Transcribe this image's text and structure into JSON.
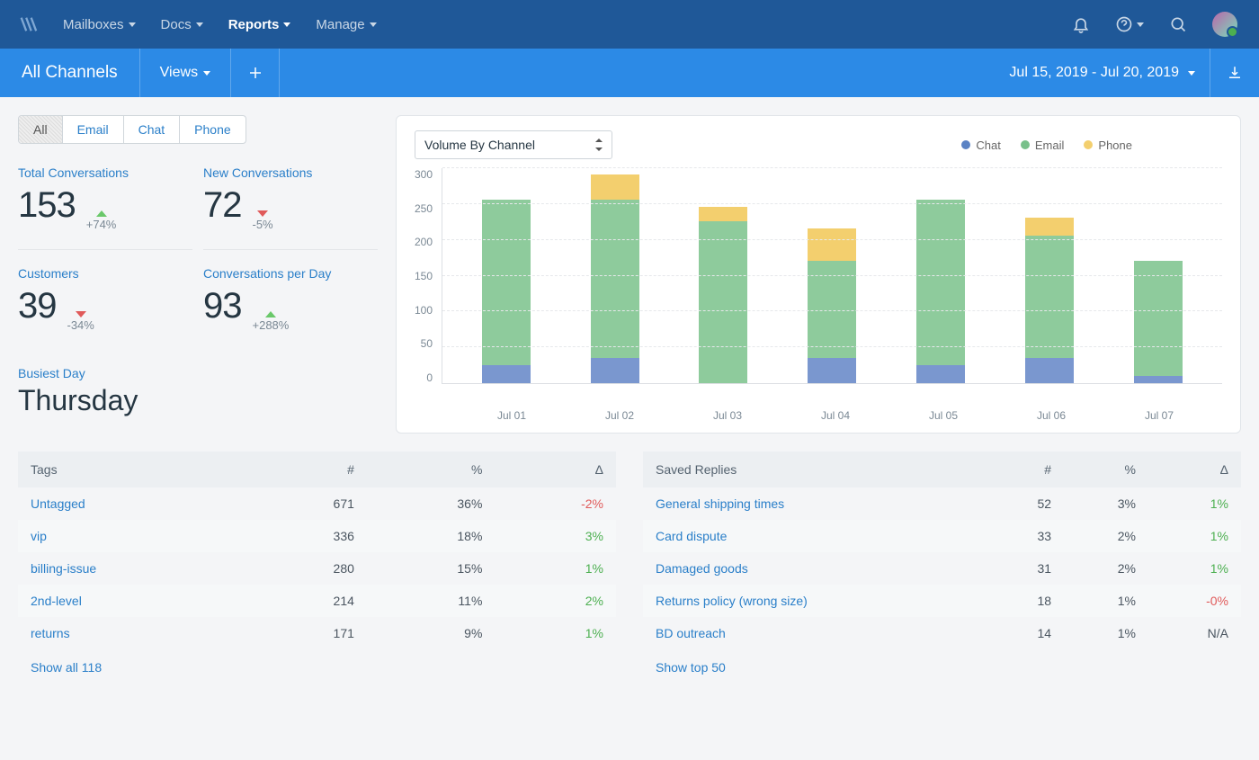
{
  "topnav": {
    "items": [
      {
        "label": "Mailboxes"
      },
      {
        "label": "Docs"
      },
      {
        "label": "Reports"
      },
      {
        "label": "Manage"
      }
    ]
  },
  "subnav": {
    "title": "All Channels",
    "views_label": "Views",
    "date_range": "Jul 15, 2019 - Jul 20, 2019"
  },
  "segments": [
    {
      "label": "All",
      "active": true
    },
    {
      "label": "Email"
    },
    {
      "label": "Chat"
    },
    {
      "label": "Phone"
    }
  ],
  "stats": {
    "total_conversations": {
      "label": "Total Conversations",
      "value": "153",
      "trend": "+74%",
      "dir": "up"
    },
    "new_conversations": {
      "label": "New Conversations",
      "value": "72",
      "trend": "-5%",
      "dir": "down"
    },
    "customers": {
      "label": "Customers",
      "value": "39",
      "trend": "-34%",
      "dir": "down"
    },
    "per_day": {
      "label": "Conversations per Day",
      "value": "93",
      "trend": "+288%",
      "dir": "up"
    },
    "busiest_label": "Busiest Day",
    "busiest_value": "Thursday"
  },
  "chart_selector": "Volume By Channel",
  "legend": {
    "chat": "Chat",
    "email": "Email",
    "phone": "Phone"
  },
  "chart_data": {
    "type": "bar",
    "title": "Volume By Channel",
    "categories": [
      "Jul 01",
      "Jul 02",
      "Jul 03",
      "Jul 04",
      "Jul 05",
      "Jul 06",
      "Jul 07"
    ],
    "series": [
      {
        "name": "Chat",
        "values": [
          25,
          35,
          0,
          35,
          25,
          35,
          10
        ]
      },
      {
        "name": "Email",
        "values": [
          230,
          220,
          225,
          135,
          230,
          170,
          160
        ]
      },
      {
        "name": "Phone",
        "values": [
          0,
          35,
          20,
          45,
          0,
          25,
          0
        ]
      }
    ],
    "ylabel": "",
    "ylim": [
      0,
      300
    ],
    "yticks": [
      0,
      50,
      100,
      150,
      200,
      250,
      300
    ]
  },
  "tags_table": {
    "title": "Tags",
    "cols": [
      "#",
      "%",
      "Δ"
    ],
    "rows": [
      {
        "name": "Untagged",
        "n": "671",
        "p": "36%",
        "d": "-2%",
        "dir": "neg"
      },
      {
        "name": "vip",
        "n": "336",
        "p": "18%",
        "d": "3%",
        "dir": "pos"
      },
      {
        "name": "billing-issue",
        "n": "280",
        "p": "15%",
        "d": "1%",
        "dir": "pos"
      },
      {
        "name": "2nd-level",
        "n": "214",
        "p": "11%",
        "d": "2%",
        "dir": "pos"
      },
      {
        "name": "returns",
        "n": "171",
        "p": "9%",
        "d": "1%",
        "dir": "pos"
      }
    ],
    "show_more": "Show all 118"
  },
  "replies_table": {
    "title": "Saved Replies",
    "cols": [
      "#",
      "%",
      "Δ"
    ],
    "rows": [
      {
        "name": "General shipping times",
        "n": "52",
        "p": "3%",
        "d": "1%",
        "dir": "pos"
      },
      {
        "name": "Card dispute",
        "n": "33",
        "p": "2%",
        "d": "1%",
        "dir": "pos"
      },
      {
        "name": "Damaged goods",
        "n": "31",
        "p": "2%",
        "d": "1%",
        "dir": "pos"
      },
      {
        "name": "Returns policy (wrong size)",
        "n": "18",
        "p": "1%",
        "d": "-0%",
        "dir": "neg"
      },
      {
        "name": "BD outreach",
        "n": "14",
        "p": "1%",
        "d": "N/A",
        "dir": "na"
      }
    ],
    "show_more": "Show top 50"
  }
}
